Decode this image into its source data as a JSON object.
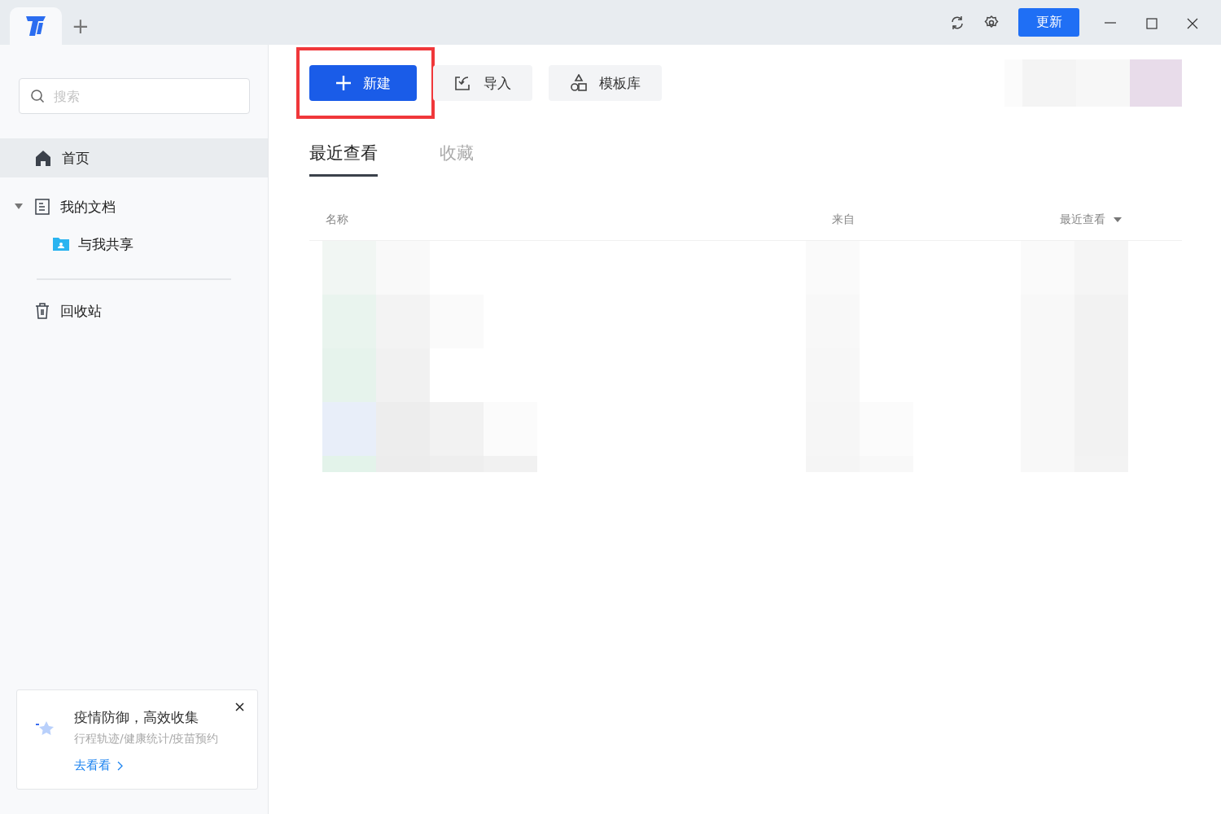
{
  "titlebar": {
    "new_tab": "+",
    "update_button": "更新"
  },
  "sidebar": {
    "search": {
      "placeholder": "搜索"
    },
    "items": [
      {
        "label": "首页",
        "kind": "home",
        "selected": true
      },
      {
        "label": "我的文档",
        "kind": "docs",
        "selected": false,
        "expanded": true,
        "children": [
          {
            "label": "与我共享",
            "kind": "shared",
            "selected": false
          }
        ]
      },
      {
        "label": "回收站",
        "kind": "trash",
        "selected": false
      }
    ],
    "promo": {
      "title": "疫情防御，高效收集",
      "subtitle": "行程轨迹/健康统计/疫苗预约",
      "link": "去看看"
    }
  },
  "toolbar": [
    {
      "label": "新建",
      "kind": "new",
      "highlighted": true
    },
    {
      "label": "导入",
      "kind": "import",
      "highlighted": false
    },
    {
      "label": "模板库",
      "kind": "templates",
      "highlighted": false
    }
  ],
  "tabs": [
    {
      "label": "最近查看",
      "selected": true
    },
    {
      "label": "收藏",
      "selected": false
    }
  ],
  "table": {
    "columns": [
      {
        "label": "名称",
        "sorted": false
      },
      {
        "label": "来自",
        "sorted": false
      },
      {
        "label": "最近查看",
        "sorted": true
      }
    ]
  }
}
